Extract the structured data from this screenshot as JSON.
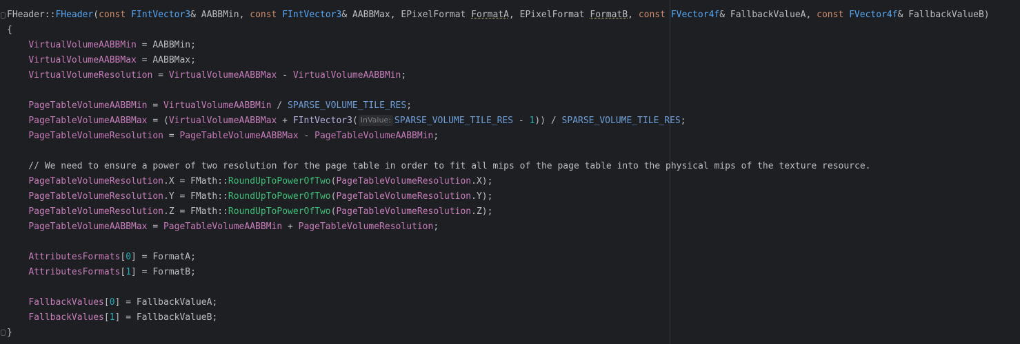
{
  "editor": {
    "lines": [
      "FHeader::FHeader(const FIntVector3& AABBMin, const FIntVector3& AABBMax, EPixelFormat FormatA, EPixelFormat FormatB, const FVector4f& FallbackValueA, const FVector4f& FallbackValueB)",
      "{",
      "    VirtualVolumeAABBMin = AABBMin;",
      "    VirtualVolumeAABBMax = AABBMax;",
      "    VirtualVolumeResolution = VirtualVolumeAABBMax - VirtualVolumeAABBMin;",
      "",
      "    PageTableVolumeAABBMin = VirtualVolumeAABBMin / SPARSE_VOLUME_TILE_RES;",
      "    PageTableVolumeAABBMax = (VirtualVolumeAABBMax + FIntVector3( SPARSE_VOLUME_TILE_RES - 1)) / SPARSE_VOLUME_TILE_RES;",
      "    PageTableVolumeResolution = PageTableVolumeAABBMax - PageTableVolumeAABBMin;",
      "",
      "    // We need to ensure a power of two resolution for the page table in order to fit all mips of the page table into the physical mips of the texture resource.",
      "    PageTableVolumeResolution.X = FMath::RoundUpToPowerOfTwo(PageTableVolumeResolution.X);",
      "    PageTableVolumeResolution.Y = FMath::RoundUpToPowerOfTwo(PageTableVolumeResolution.Y);",
      "    PageTableVolumeResolution.Z = FMath::RoundUpToPowerOfTwo(PageTableVolumeResolution.Z);",
      "    PageTableVolumeAABBMax = PageTableVolumeAABBMin + PageTableVolumeResolution;",
      "",
      "    AttributesFormats[0] = FormatA;",
      "    AttributesFormats[1] = FormatB;",
      "",
      "    FallbackValues[0] = FallbackValueA;",
      "    FallbackValues[1] = FallbackValueB;",
      "}"
    ],
    "inlay_hint": "InValue:",
    "colors": {
      "background": "#1e1f22",
      "text": "#bcbec4",
      "keyword": "#cf8e6d",
      "function": "#57aaf7",
      "field": "#c77dbb",
      "number": "#2aacb8",
      "static_call": "#3fbf78",
      "comment": "#7a9e5e",
      "macro": "#6f9fd9"
    }
  }
}
